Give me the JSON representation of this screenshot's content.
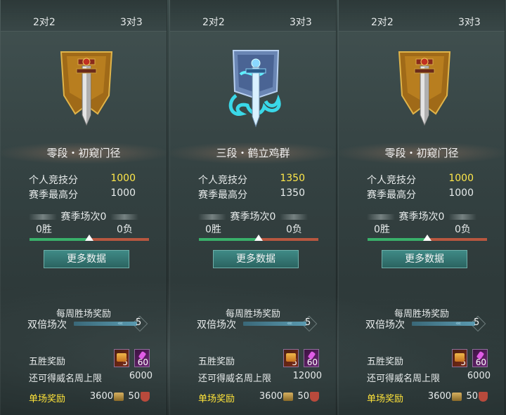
{
  "panels": [
    {
      "modes": [
        "2对2",
        "3对3"
      ],
      "rank_title": "零段・初窥门径",
      "emblem_icon": "gold-banner-sword-emblem-icon",
      "personal_score_label": "个人竞技分",
      "personal_score": "1000",
      "season_high_label": "赛季最高分",
      "season_high": "1000",
      "season_matches": "赛季场次0",
      "wins": "0胜",
      "losses": "0负",
      "win_ratio": 0.5,
      "more_button": "更多数据",
      "weekly_title": "每周胜场奖励",
      "double_label": "双倍场次",
      "double_count": "5",
      "five_win_label": "五胜奖励",
      "five_win_items": [
        {
          "icon": "treasure-chest-icon",
          "count": "5"
        },
        {
          "icon": "potion-icon",
          "count": "60"
        }
      ],
      "weekly_cap_label": "还可得威名周上限",
      "weekly_cap": "6000",
      "single_reward_label": "单场奖励",
      "single_reward_coin": "3600",
      "single_reward_honor": "50"
    },
    {
      "modes": [
        "2对2",
        "3对3"
      ],
      "rank_title": "三段・鹤立鸡群",
      "emblem_icon": "blue-dragon-banner-sword-emblem-icon",
      "personal_score_label": "个人竞技分",
      "personal_score": "1350",
      "season_high_label": "赛季最高分",
      "season_high": "1350",
      "season_matches": "赛季场次0",
      "wins": "0胜",
      "losses": "0负",
      "win_ratio": 0.5,
      "more_button": "更多数据",
      "weekly_title": "每周胜场奖励",
      "double_label": "双倍场次",
      "double_count": "5",
      "five_win_label": "五胜奖励",
      "five_win_items": [
        {
          "icon": "treasure-chest-icon",
          "count": "5"
        },
        {
          "icon": "potion-icon",
          "count": "60"
        }
      ],
      "weekly_cap_label": "还可得威名周上限",
      "weekly_cap": "12000",
      "single_reward_label": "单场奖励",
      "single_reward_coin": "3600",
      "single_reward_honor": "50"
    },
    {
      "modes": [
        "2对2",
        "3对3"
      ],
      "rank_title": "零段・初窥门径",
      "emblem_icon": "gold-banner-sword-emblem-icon",
      "personal_score_label": "个人竞技分",
      "personal_score": "1000",
      "season_high_label": "赛季最高分",
      "season_high": "1000",
      "season_matches": "赛季场次0",
      "wins": "0胜",
      "losses": "0负",
      "win_ratio": 0.5,
      "more_button": "更多数据",
      "weekly_title": "每周胜场奖励",
      "double_label": "双倍场次",
      "double_count": "5",
      "five_win_label": "五胜奖励",
      "five_win_items": [
        {
          "icon": "treasure-chest-icon",
          "count": "5"
        },
        {
          "icon": "potion-icon",
          "count": "60"
        }
      ],
      "weekly_cap_label": "还可得威名周上限",
      "weekly_cap": "6000",
      "single_reward_label": "单场奖励",
      "single_reward_coin": "3600",
      "single_reward_honor": "50"
    }
  ],
  "colors": {
    "score_gold": "#ffe84a",
    "single_reward_yellow": "#ffe43a",
    "win_green": "#39b06a",
    "loss_red": "#b8573f",
    "button_teal": "#3f8a86"
  }
}
